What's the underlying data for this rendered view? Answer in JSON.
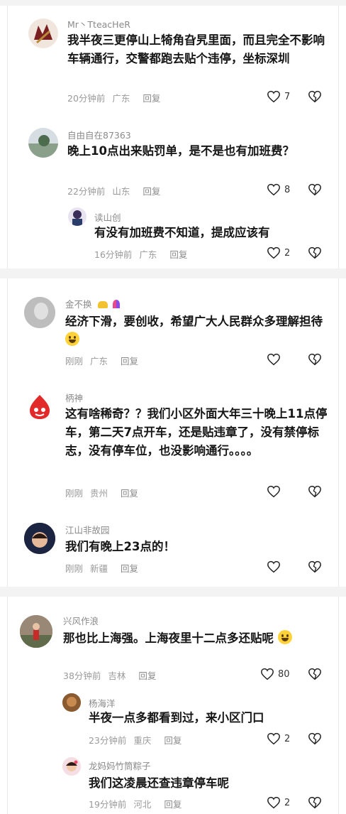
{
  "comments": [
    {
      "user": "Mr丶TteacHeR",
      "text": "我半夜三更停山上犄角旮旯里面，而且完全不影响车辆通行，交警都跑去贴个违停，坐标深圳",
      "time": "20分钟前",
      "location": "广东",
      "reply": "回复",
      "likes": "7"
    },
    {
      "user": "自由自在87363",
      "text": "晚上10点出来贴罚单，是不是也有加班费？",
      "time": "22分钟前",
      "location": "山东",
      "reply": "回复",
      "likes": "8"
    },
    {
      "user": "读山创",
      "text": "有没有加班费不知道，提成应该有",
      "time": "16分钟前",
      "location": "广东",
      "reply": "回复",
      "likes": "2"
    },
    {
      "user": "金不换",
      "text": "经济下滑，要创收，希望广大人民群众多理解担待",
      "time": "刚刚",
      "location": "广东",
      "reply": "回复",
      "likes": ""
    },
    {
      "user": "柄神",
      "text": "这有啥稀奇？？我们小区外面大年三十晚上11点停车，第二天7点开车，还是贴违章了，没有禁停标志，没有停车位，也没影响通行。。。。",
      "time": "刚刚",
      "location": "贵州",
      "reply": "回复",
      "likes": ""
    },
    {
      "user": "江山非故园",
      "text": "我们有晚上23点的！",
      "time": "刚刚",
      "location": "新疆",
      "reply": "回复",
      "likes": ""
    },
    {
      "user": "兴风作浪",
      "text": "那也比上海强。上海夜里十二点多还贴呢",
      "time": "38分钟前",
      "location": "吉林",
      "reply": "回复",
      "likes": "80"
    },
    {
      "user": "杨海洋",
      "text": "半夜一点多都看到过，来小区门口",
      "time": "23分钟前",
      "location": "重庆",
      "reply": "回复",
      "likes": "2"
    },
    {
      "user": "龙妈妈竹筒粽子",
      "text": "我们这凌晨还查违章停车呢",
      "time": "19分钟前",
      "location": "河北",
      "reply": "回复",
      "likes": "2"
    }
  ],
  "icons": {
    "like": "heart-outline-icon",
    "dislike": "broken-heart-outline-icon",
    "emoji": "grinning-face-emoji"
  },
  "colors": {
    "text": "#161616",
    "meta": "#9a9a9a",
    "username": "#8a8a8a",
    "background": "#ffffff",
    "separator": "#f3f3f3"
  }
}
